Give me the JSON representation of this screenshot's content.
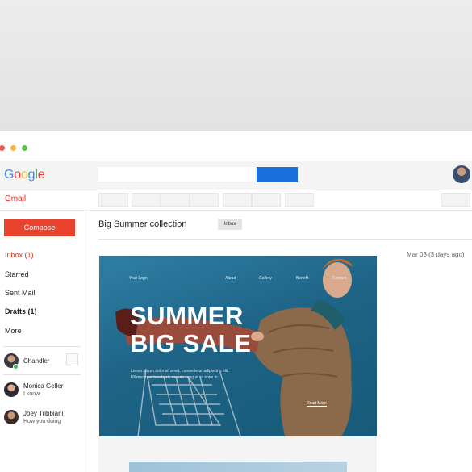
{
  "app": {
    "logo": "Google",
    "brand": "Gmail",
    "search": {
      "placeholder": "",
      "value": ""
    },
    "window_buttons": [
      "close",
      "minimize",
      "maximize"
    ]
  },
  "sidebar": {
    "compose_label": "Compose",
    "items": [
      {
        "label": "Inbox (1)",
        "active": true
      },
      {
        "label": "Starred"
      },
      {
        "label": "Sent Mail"
      },
      {
        "label": "Drafts (1)",
        "bold": true
      },
      {
        "label": "More"
      }
    ],
    "contacts": [
      {
        "name": "Chandler",
        "status": ""
      },
      {
        "name": "Monica Geller",
        "status": "I know"
      },
      {
        "name": "Joey Tribbiani",
        "status": "How you doing"
      }
    ]
  },
  "email": {
    "subject": "Big Summer collection",
    "label": "Inbox",
    "date": "Mar 03 (3 days ago)",
    "hero": {
      "logo": "Your Logo",
      "nav": [
        "About",
        "Gallery",
        "Benefit",
        "Contact"
      ],
      "title_line1": "SUMMER",
      "title_line2": "BIG SALE",
      "body": "Lorem ipsum dolor sit amet, consectetur adipiscing elit. Ullamcorper hendrerit, mauris congue sit enim in.",
      "cta": "Read More"
    }
  },
  "colors": {
    "compose": "#e9432f",
    "search_button": "#1a6fdf",
    "active_item": "#d93025",
    "hero_bg": "#1e6487"
  }
}
